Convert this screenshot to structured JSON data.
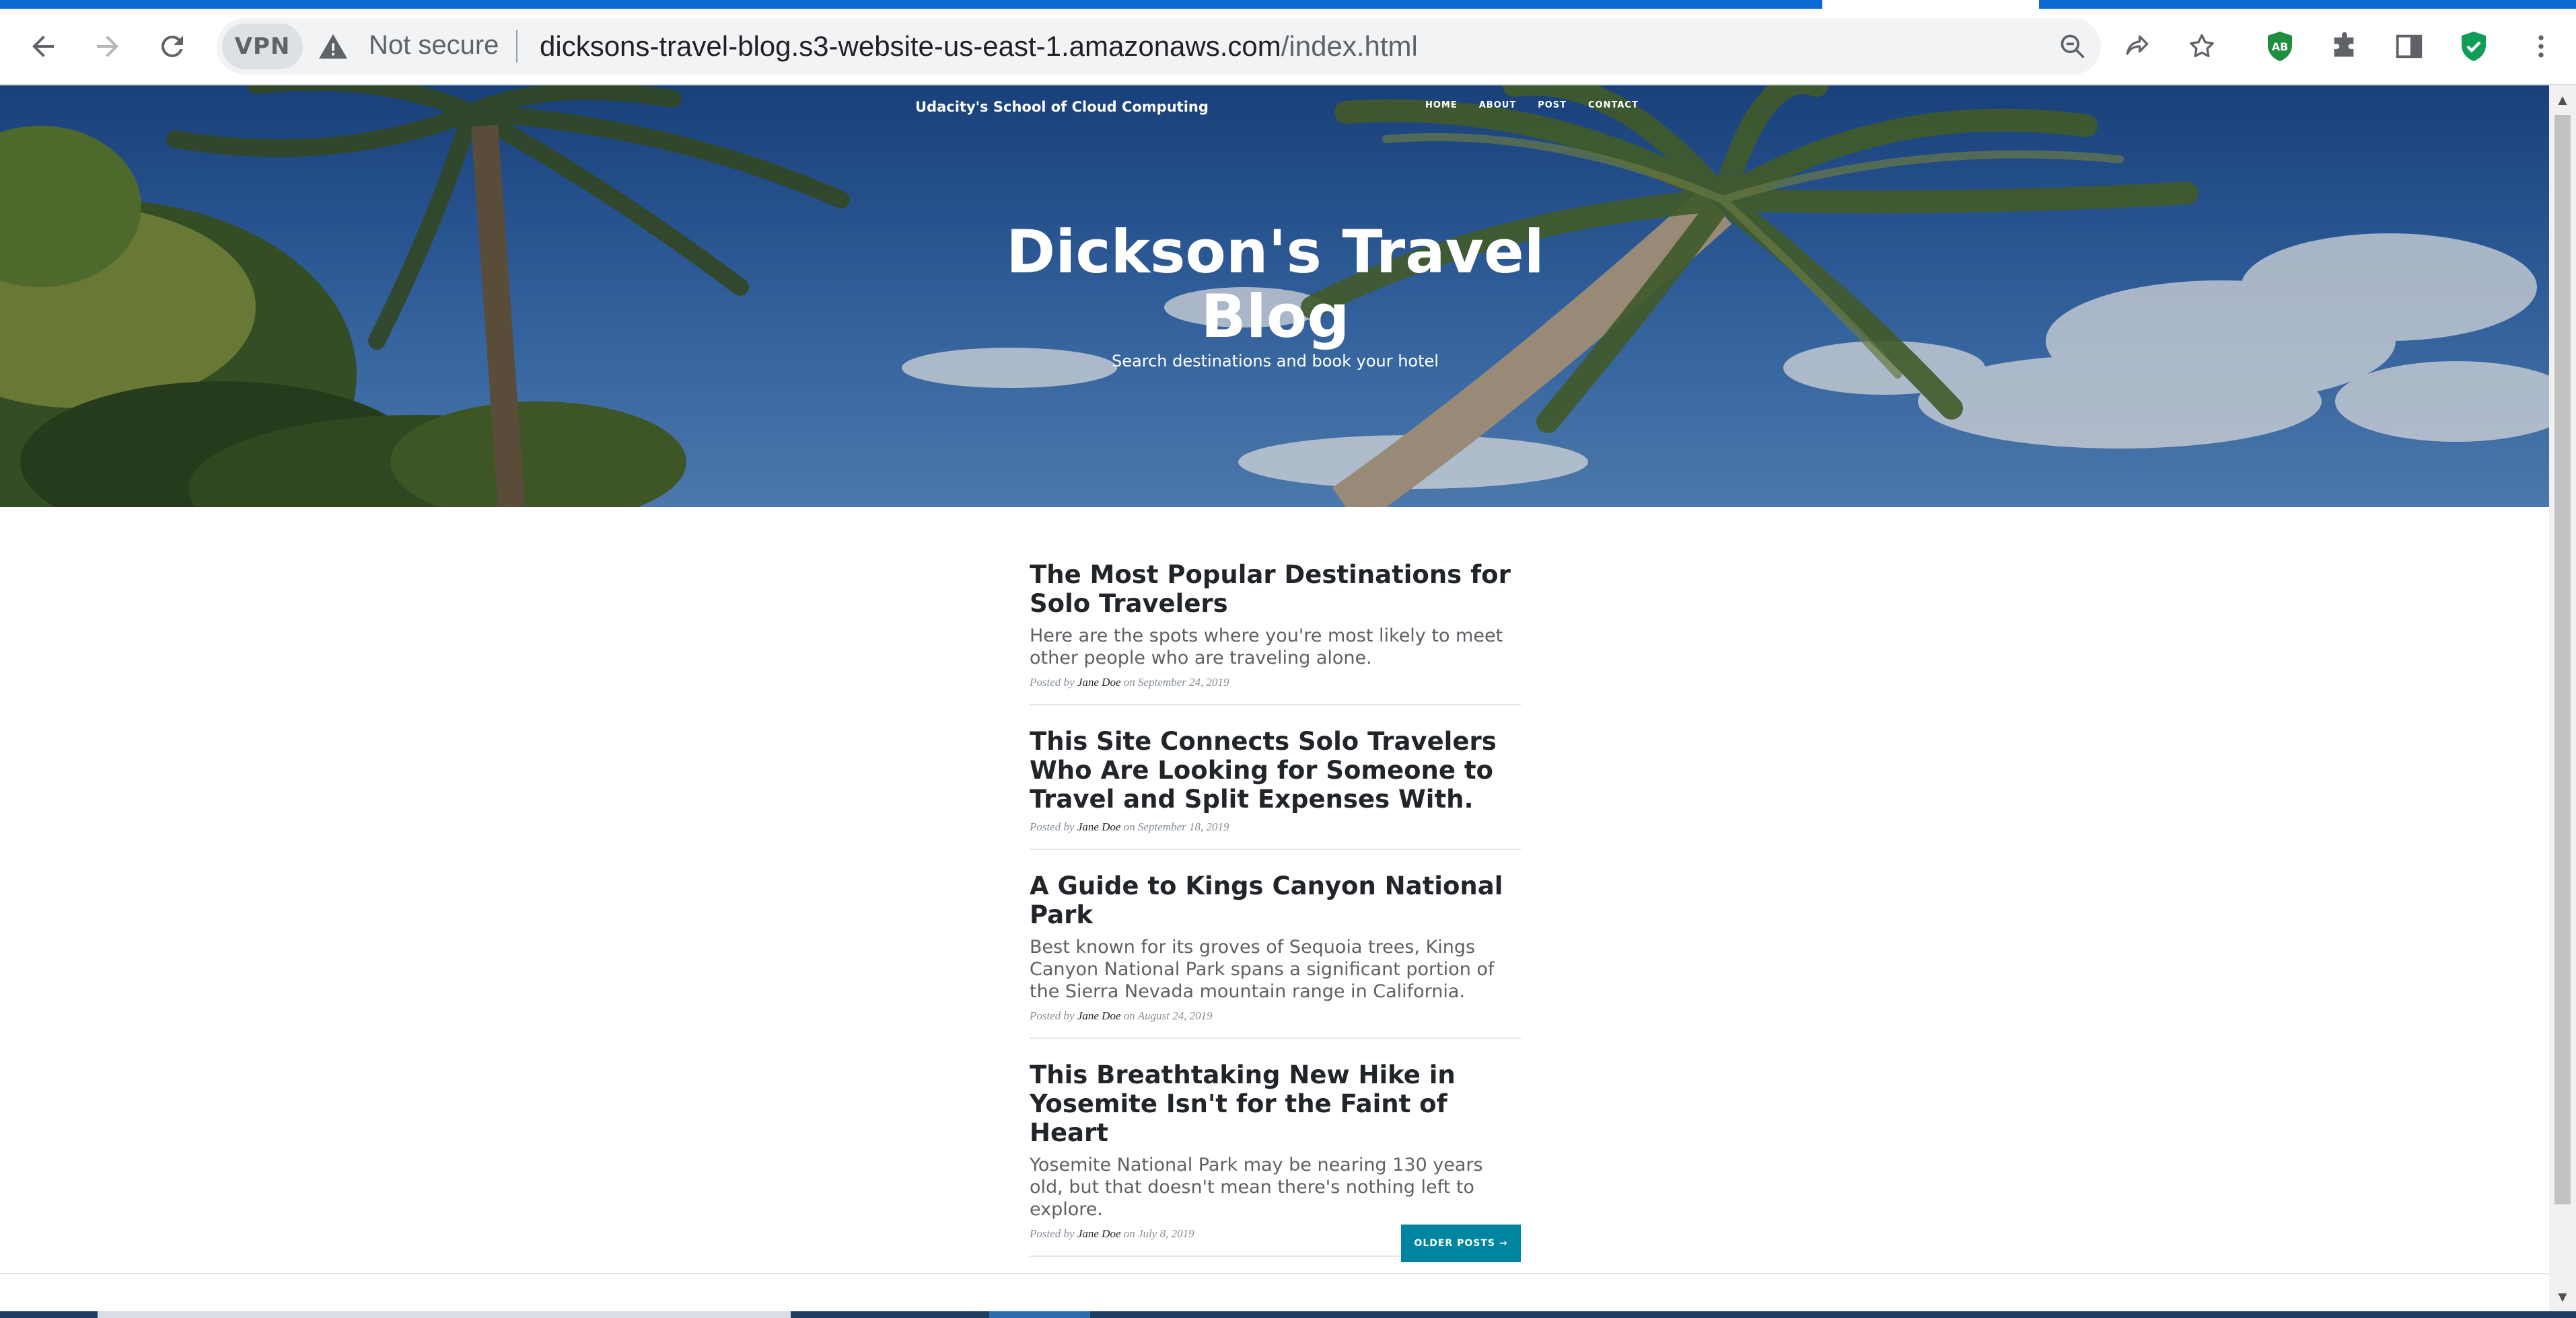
{
  "browser": {
    "vpn_label": "VPN",
    "security_text": "Not secure",
    "url_host": "dicksons-travel-blog.s3-website-us-east-1.amazonaws.com",
    "url_path": "/index.html",
    "extension_badge": "AB",
    "colors": {
      "accent": "#0b6bd3",
      "ext_badge": "#1e8e3e",
      "shield": "#0f9d58"
    }
  },
  "site": {
    "brand": "Udacity's School of Cloud Computing",
    "nav": [
      "HOME",
      "ABOUT",
      "POST",
      "CONTACT"
    ],
    "hero_title": "Dickson's Travel Blog",
    "hero_subtitle": "Search destinations and book your hotel"
  },
  "posts": [
    {
      "title": "The Most Popular Destinations for Solo Travelers",
      "subtitle": "Here are the spots where you're most likely to meet other people who are traveling alone.",
      "meta_prefix": "Posted by",
      "author": "Jane Doe",
      "meta_date": "on September 24, 2019"
    },
    {
      "title": "This Site Connects Solo Travelers Who Are Looking for Someone to Travel and Split Expenses With.",
      "subtitle": "",
      "meta_prefix": "Posted by",
      "author": "Jane Doe",
      "meta_date": "on September 18, 2019"
    },
    {
      "title": "A Guide to Kings Canyon National Park",
      "subtitle": "Best known for its groves of Sequoia trees, Kings Canyon National Park spans a significant portion of the Sierra Nevada mountain range in California.",
      "meta_prefix": "Posted by",
      "author": "Jane Doe",
      "meta_date": "on August 24, 2019"
    },
    {
      "title": "This Breathtaking New Hike in Yosemite Isn't for the Faint of Heart",
      "subtitle": "Yosemite National Park may be nearing 130 years old, but that doesn't mean there's nothing left to explore.",
      "meta_prefix": "Posted by",
      "author": "Jane Doe",
      "meta_date": "on July 8, 2019"
    }
  ],
  "pager": {
    "older_label": "OLDER POSTS →"
  },
  "theme": {
    "button_color": "#0085a1",
    "title_color": "#212529"
  }
}
